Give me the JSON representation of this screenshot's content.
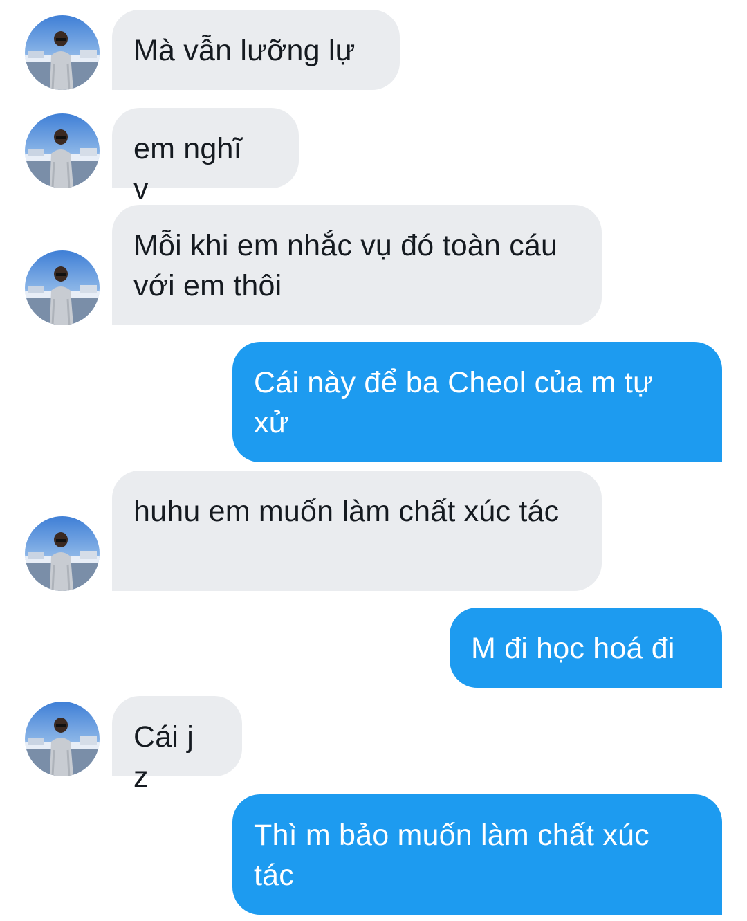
{
  "colors": {
    "incoming_bubble": "#eaecef",
    "incoming_text": "#151a20",
    "outgoing_bubble": "#1d9bf0",
    "outgoing_text": "#ffffff"
  },
  "contact": {
    "avatar_icon": "profile-photo-avatar"
  },
  "messages": [
    {
      "sender": "them",
      "text": "Mà vẫn lưỡng lự"
    },
    {
      "sender": "them",
      "text": "em nghĩ v"
    },
    {
      "sender": "them",
      "text": "Mỗi khi em nhắc vụ đó toàn cáu với em thôi"
    },
    {
      "sender": "me",
      "text": "Cái này để ba Cheol của m tự xử"
    },
    {
      "sender": "them",
      "text": "huhu em muốn làm chất xúc tác"
    },
    {
      "sender": "me",
      "text": "M đi học hoá đi"
    },
    {
      "sender": "them",
      "text": "Cái j z"
    },
    {
      "sender": "me",
      "text": "Thì m bảo muốn làm chất xúc tác"
    }
  ]
}
